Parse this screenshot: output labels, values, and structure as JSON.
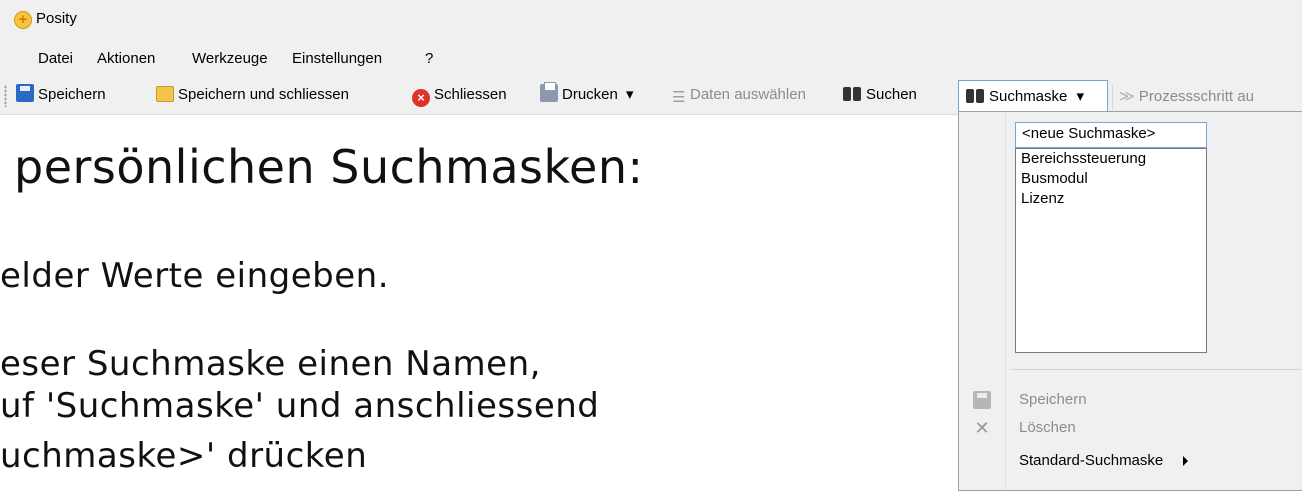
{
  "window": {
    "title": "Posity",
    "app_icon": "plus-circle-icon"
  },
  "menu": [
    "Datei",
    "Aktionen",
    "Werkzeuge",
    "Einstellungen",
    "?"
  ],
  "toolbar": {
    "save": "Speichern",
    "save_close": "Speichern und schliessen",
    "close": "Schliessen",
    "print": "Drucken",
    "print_arrow": "▾",
    "select_data": "Daten auswählen",
    "search": "Suchen",
    "search_mask": "Suchmaske",
    "search_mask_arrow": "▾",
    "process_arrows": "≫",
    "process_step": "Prozessschritt au"
  },
  "slide": {
    "heading": "persönlichen Suchmasken:",
    "line1": "elder Werte eingeben.",
    "line2": "eser Suchmaske einen Namen,",
    "line3": "uf 'Suchmaske' und anschliessend",
    "line4": "uchmaske>' drücken"
  },
  "search_mask_dropdown": {
    "input_value": "<neue Suchmaske>",
    "items": [
      "Bereichssteuerung",
      "Busmodul",
      "Lizenz"
    ],
    "save": "Speichern",
    "delete": "Löschen",
    "default_mask": "Standard-Suchmaske"
  }
}
